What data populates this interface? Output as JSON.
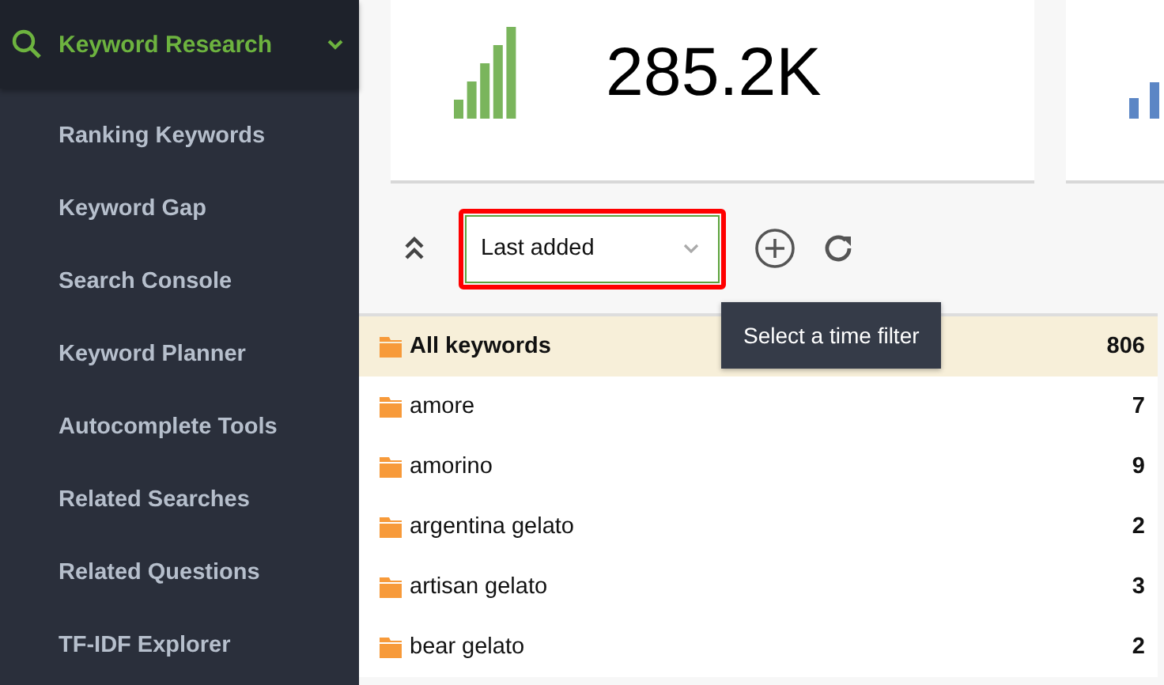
{
  "sidebar": {
    "section": {
      "label": "Keyword Research",
      "expanded": true
    },
    "items": [
      "Ranking Keywords",
      "Keyword Gap",
      "Search Console",
      "Keyword Planner",
      "Autocomplete Tools",
      "Related Searches",
      "Related Questions",
      "TF-IDF Explorer"
    ]
  },
  "stats": [
    {
      "value": "285.2K",
      "color": "#7ab55c"
    },
    {
      "color": "#5b86c5"
    }
  ],
  "toolbar": {
    "filter": {
      "value": "Last added",
      "highlighted": true
    },
    "tooltip": "Select a time filter"
  },
  "folders": [
    {
      "name": "All keywords",
      "count": "806",
      "selected": true
    },
    {
      "name": "amore",
      "count": "7",
      "selected": false
    },
    {
      "name": "amorino",
      "count": "9",
      "selected": false
    },
    {
      "name": "argentina gelato",
      "count": "2",
      "selected": false
    },
    {
      "name": "artisan gelato",
      "count": "3",
      "selected": false
    },
    {
      "name": "bear gelato",
      "count": "2",
      "selected": false
    }
  ]
}
